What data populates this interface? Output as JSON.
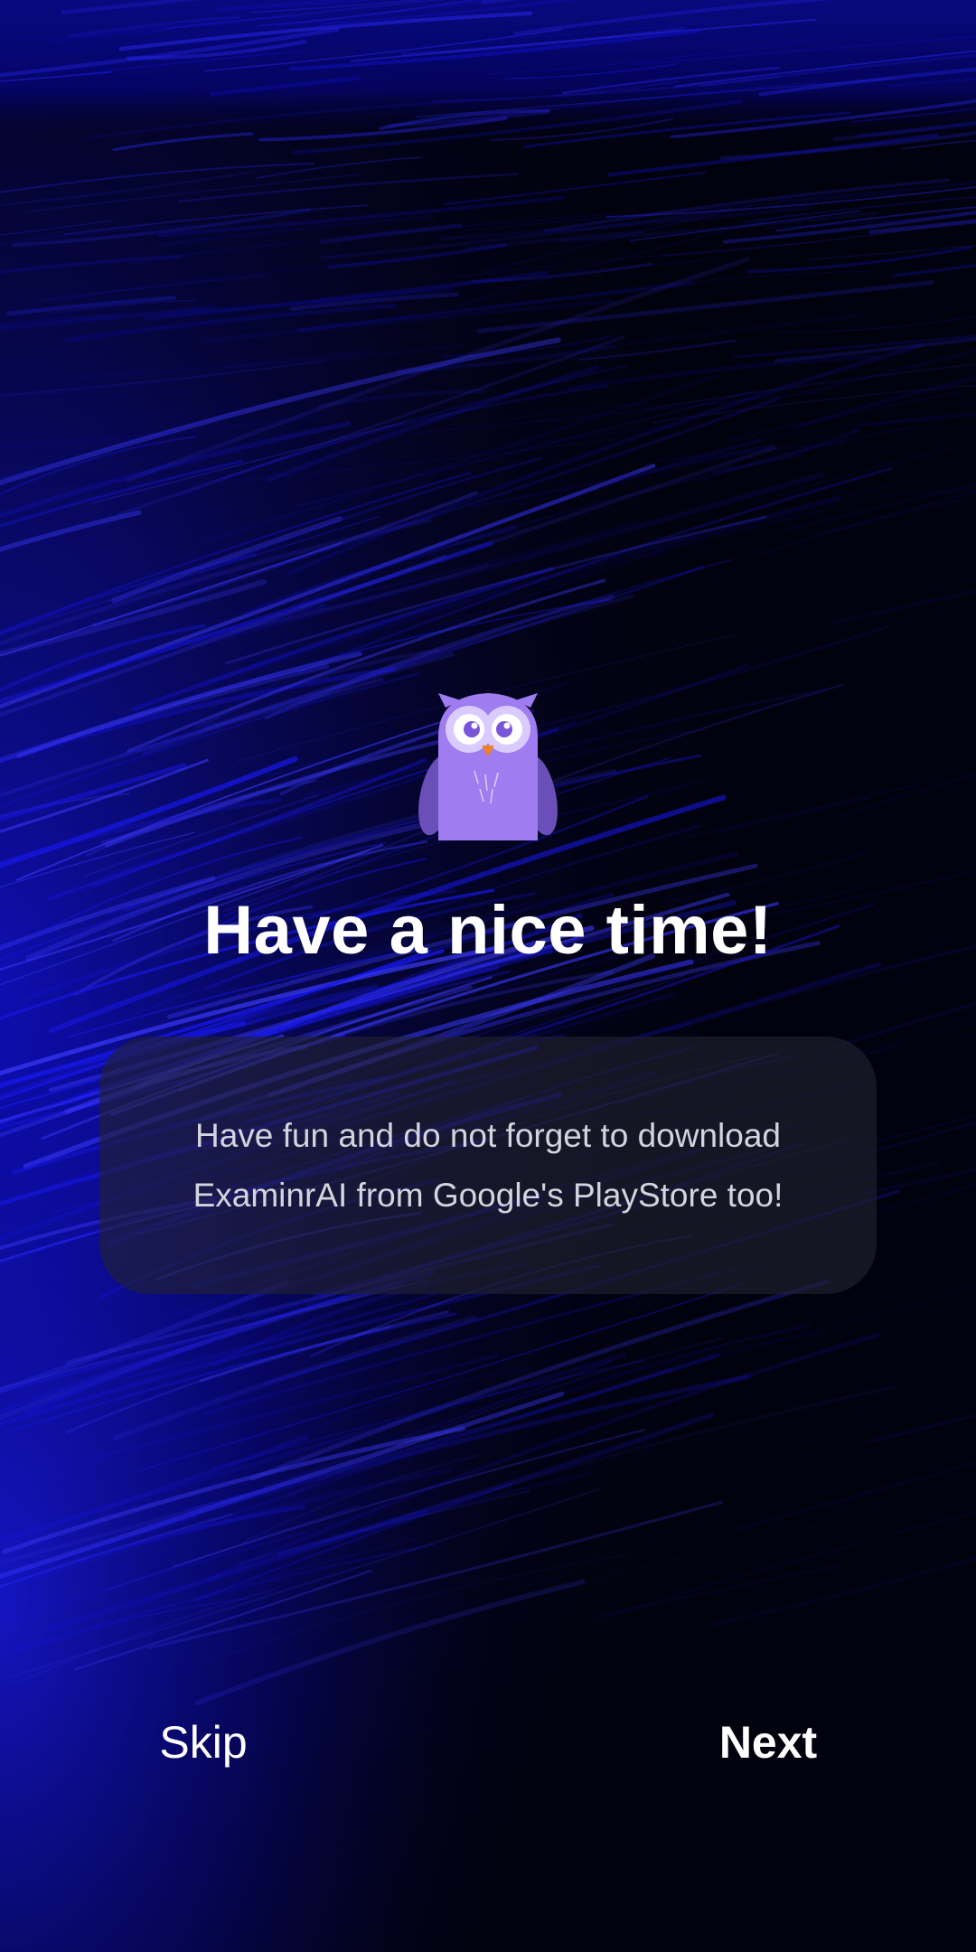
{
  "colors": {
    "background": "#02020f",
    "accent_blue": "#1a1aff",
    "mascot_purple": "#9f7cf0",
    "card": "#222230",
    "text_primary": "#ffffff",
    "text_secondary": "#d4d4de"
  },
  "onboarding": {
    "mascot_icon": "owl-icon",
    "title": "Have a nice time!",
    "message": "Have fun and do not forget to download ExaminrAI from Google's PlayStore too!"
  },
  "footer": {
    "skip_label": "Skip",
    "next_label": "Next"
  }
}
